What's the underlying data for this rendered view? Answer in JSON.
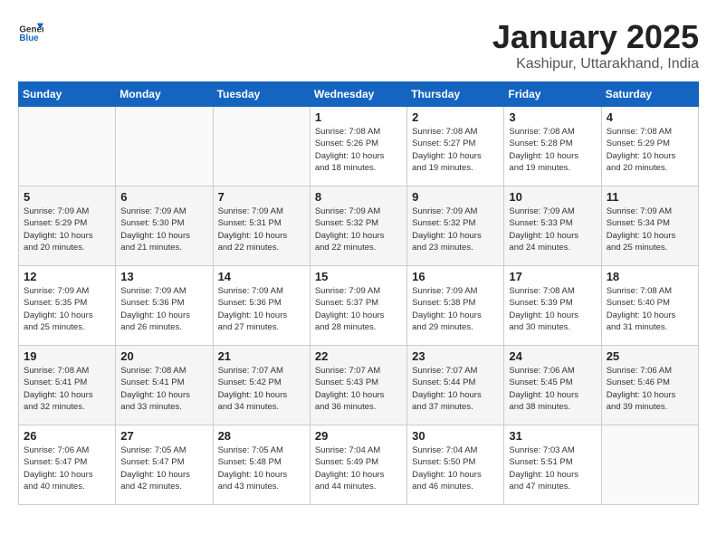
{
  "header": {
    "logo_general": "General",
    "logo_blue": "Blue",
    "title": "January 2025",
    "subtitle": "Kashipur, Uttarakhand, India"
  },
  "days_of_week": [
    "Sunday",
    "Monday",
    "Tuesday",
    "Wednesday",
    "Thursday",
    "Friday",
    "Saturday"
  ],
  "weeks": [
    [
      {
        "day": "",
        "info": ""
      },
      {
        "day": "",
        "info": ""
      },
      {
        "day": "",
        "info": ""
      },
      {
        "day": "1",
        "info": "Sunrise: 7:08 AM\nSunset: 5:26 PM\nDaylight: 10 hours\nand 18 minutes."
      },
      {
        "day": "2",
        "info": "Sunrise: 7:08 AM\nSunset: 5:27 PM\nDaylight: 10 hours\nand 19 minutes."
      },
      {
        "day": "3",
        "info": "Sunrise: 7:08 AM\nSunset: 5:28 PM\nDaylight: 10 hours\nand 19 minutes."
      },
      {
        "day": "4",
        "info": "Sunrise: 7:08 AM\nSunset: 5:29 PM\nDaylight: 10 hours\nand 20 minutes."
      }
    ],
    [
      {
        "day": "5",
        "info": "Sunrise: 7:09 AM\nSunset: 5:29 PM\nDaylight: 10 hours\nand 20 minutes."
      },
      {
        "day": "6",
        "info": "Sunrise: 7:09 AM\nSunset: 5:30 PM\nDaylight: 10 hours\nand 21 minutes."
      },
      {
        "day": "7",
        "info": "Sunrise: 7:09 AM\nSunset: 5:31 PM\nDaylight: 10 hours\nand 22 minutes."
      },
      {
        "day": "8",
        "info": "Sunrise: 7:09 AM\nSunset: 5:32 PM\nDaylight: 10 hours\nand 22 minutes."
      },
      {
        "day": "9",
        "info": "Sunrise: 7:09 AM\nSunset: 5:32 PM\nDaylight: 10 hours\nand 23 minutes."
      },
      {
        "day": "10",
        "info": "Sunrise: 7:09 AM\nSunset: 5:33 PM\nDaylight: 10 hours\nand 24 minutes."
      },
      {
        "day": "11",
        "info": "Sunrise: 7:09 AM\nSunset: 5:34 PM\nDaylight: 10 hours\nand 25 minutes."
      }
    ],
    [
      {
        "day": "12",
        "info": "Sunrise: 7:09 AM\nSunset: 5:35 PM\nDaylight: 10 hours\nand 25 minutes."
      },
      {
        "day": "13",
        "info": "Sunrise: 7:09 AM\nSunset: 5:36 PM\nDaylight: 10 hours\nand 26 minutes."
      },
      {
        "day": "14",
        "info": "Sunrise: 7:09 AM\nSunset: 5:36 PM\nDaylight: 10 hours\nand 27 minutes."
      },
      {
        "day": "15",
        "info": "Sunrise: 7:09 AM\nSunset: 5:37 PM\nDaylight: 10 hours\nand 28 minutes."
      },
      {
        "day": "16",
        "info": "Sunrise: 7:09 AM\nSunset: 5:38 PM\nDaylight: 10 hours\nand 29 minutes."
      },
      {
        "day": "17",
        "info": "Sunrise: 7:08 AM\nSunset: 5:39 PM\nDaylight: 10 hours\nand 30 minutes."
      },
      {
        "day": "18",
        "info": "Sunrise: 7:08 AM\nSunset: 5:40 PM\nDaylight: 10 hours\nand 31 minutes."
      }
    ],
    [
      {
        "day": "19",
        "info": "Sunrise: 7:08 AM\nSunset: 5:41 PM\nDaylight: 10 hours\nand 32 minutes."
      },
      {
        "day": "20",
        "info": "Sunrise: 7:08 AM\nSunset: 5:41 PM\nDaylight: 10 hours\nand 33 minutes."
      },
      {
        "day": "21",
        "info": "Sunrise: 7:07 AM\nSunset: 5:42 PM\nDaylight: 10 hours\nand 34 minutes."
      },
      {
        "day": "22",
        "info": "Sunrise: 7:07 AM\nSunset: 5:43 PM\nDaylight: 10 hours\nand 36 minutes."
      },
      {
        "day": "23",
        "info": "Sunrise: 7:07 AM\nSunset: 5:44 PM\nDaylight: 10 hours\nand 37 minutes."
      },
      {
        "day": "24",
        "info": "Sunrise: 7:06 AM\nSunset: 5:45 PM\nDaylight: 10 hours\nand 38 minutes."
      },
      {
        "day": "25",
        "info": "Sunrise: 7:06 AM\nSunset: 5:46 PM\nDaylight: 10 hours\nand 39 minutes."
      }
    ],
    [
      {
        "day": "26",
        "info": "Sunrise: 7:06 AM\nSunset: 5:47 PM\nDaylight: 10 hours\nand 40 minutes."
      },
      {
        "day": "27",
        "info": "Sunrise: 7:05 AM\nSunset: 5:47 PM\nDaylight: 10 hours\nand 42 minutes."
      },
      {
        "day": "28",
        "info": "Sunrise: 7:05 AM\nSunset: 5:48 PM\nDaylight: 10 hours\nand 43 minutes."
      },
      {
        "day": "29",
        "info": "Sunrise: 7:04 AM\nSunset: 5:49 PM\nDaylight: 10 hours\nand 44 minutes."
      },
      {
        "day": "30",
        "info": "Sunrise: 7:04 AM\nSunset: 5:50 PM\nDaylight: 10 hours\nand 46 minutes."
      },
      {
        "day": "31",
        "info": "Sunrise: 7:03 AM\nSunset: 5:51 PM\nDaylight: 10 hours\nand 47 minutes."
      },
      {
        "day": "",
        "info": ""
      }
    ]
  ]
}
